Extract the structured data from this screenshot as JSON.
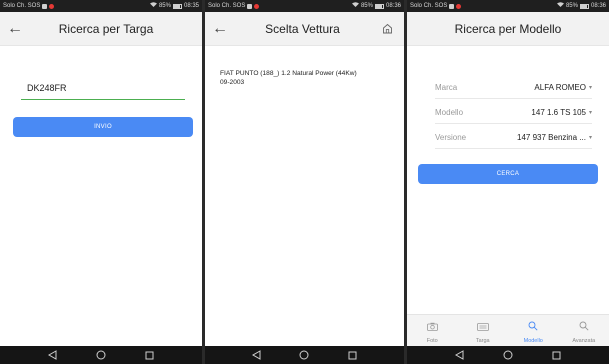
{
  "status": {
    "carrier": "Solo Ch. SOS",
    "battery": "85%",
    "times": [
      "08:35",
      "08:36",
      "08:36"
    ]
  },
  "panel1": {
    "title": "Ricerca per Targa",
    "plate_value": "DK248FR",
    "invio_label": "INVIO"
  },
  "panel2": {
    "title": "Scelta Vettura",
    "result_name": "FIAT PUNTO (188_) 1.2 Natural Power (44Kw)",
    "result_date": "09-2003"
  },
  "panel3": {
    "title": "Ricerca per Modello",
    "rows": [
      {
        "label": "Marca",
        "value": "ALFA ROMEO"
      },
      {
        "label": "Modello",
        "value": "147 1.6 TS 105"
      },
      {
        "label": "Versione",
        "value": "147 937 Benzina ..."
      }
    ],
    "cerca_label": "CERCA",
    "tabs": [
      {
        "label": "Foto",
        "icon": "camera-icon",
        "active": false
      },
      {
        "label": "Targa",
        "icon": "plate-icon",
        "active": false
      },
      {
        "label": "Modello",
        "icon": "search-icon",
        "active": true
      },
      {
        "label": "Avanzata",
        "icon": "search-icon",
        "active": false
      }
    ]
  },
  "colors": {
    "accent": "#4a8af4",
    "field_underline": "#4caf50",
    "status_bar": "#1f1f1f",
    "nav_bar": "#151515"
  }
}
